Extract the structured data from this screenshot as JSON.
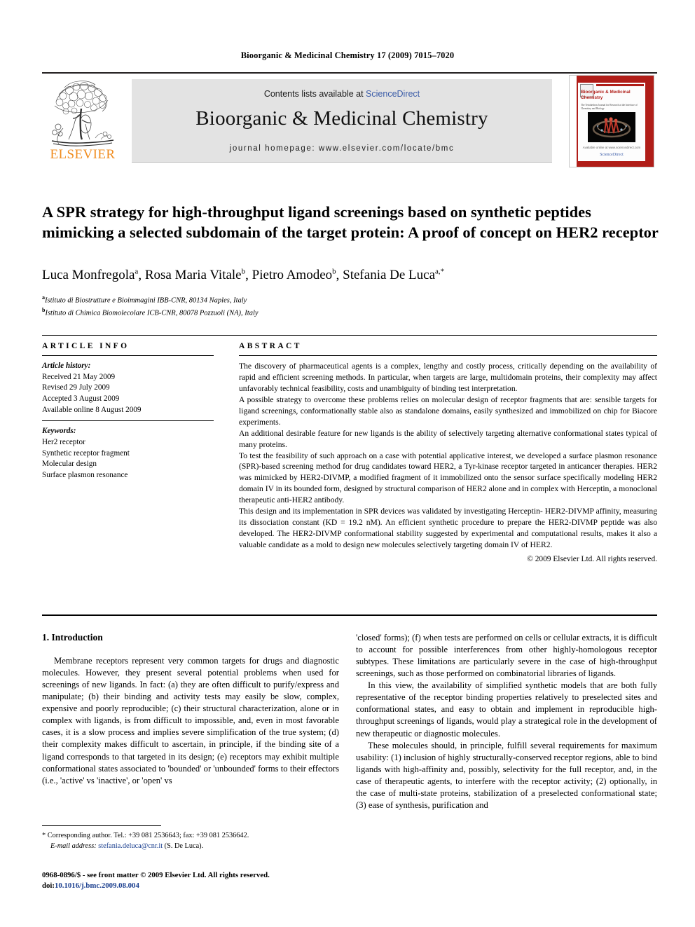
{
  "running_head": "Bioorganic & Medicinal Chemistry 17 (2009) 7015–7020",
  "masthead": {
    "contents_prefix": "Contents lists available at ",
    "sciencedirect": "ScienceDirect",
    "journal_title": "Bioorganic & Medicinal Chemistry",
    "homepage": "journal homepage: www.elsevier.com/locate/bmc",
    "publisher_wordmark": "ELSEVIER",
    "publisher_logo_name": "elsevier-tree-logo",
    "accent_blue": "#3b5ca8",
    "accent_orange": "#F08C1E",
    "band_gray": "#e3e3e3"
  },
  "cover": {
    "title": "Bioorganic & Medicinal Chemistry",
    "subtitle": "The Tetrahedron Journal for Research at the Interface of Chemistry and Biology",
    "footer": "Available online at www.sciencedirect.com",
    "sciencedirect": "ScienceDirect",
    "border_color": "#b01d18"
  },
  "article": {
    "title": "A SPR strategy for high-throughput ligand screenings based on synthetic peptides mimicking a selected subdomain of the target protein: A proof of concept on HER2 receptor",
    "authors": [
      {
        "name": "Luca Monfregola",
        "mark": "a"
      },
      {
        "name": "Rosa Maria Vitale",
        "mark": "b"
      },
      {
        "name": "Pietro Amodeo",
        "mark": "b"
      },
      {
        "name": "Stefania De Luca",
        "mark": "a,*"
      }
    ],
    "affiliations": [
      {
        "mark": "a",
        "text": "Istituto di Biostrutture e Bioimmagini IBB-CNR, 80134 Naples, Italy"
      },
      {
        "mark": "b",
        "text": "Istituto di Chimica Biomolecolare ICB-CNR, 80078 Pozzuoli (NA), Italy"
      }
    ]
  },
  "article_info": {
    "heading": "ARTICLE INFO",
    "history_label": "Article history:",
    "history": [
      "Received 21 May 2009",
      "Revised 29 July 2009",
      "Accepted 3 August 2009",
      "Available online 8 August 2009"
    ],
    "keywords_label": "Keywords:",
    "keywords": [
      "Her2 receptor",
      "Synthetic receptor fragment",
      "Molecular design",
      "Surface plasmon resonance"
    ]
  },
  "abstract": {
    "heading": "ABSTRACT",
    "paragraphs": [
      "The discovery of pharmaceutical agents is a complex, lengthy and costly process, critically depending on the availability of rapid and efficient screening methods. In particular, when targets are large, multidomain proteins, their complexity may affect unfavorably technical feasibility, costs and unambiguity of binding test interpretation.",
      "A possible strategy to overcome these problems relies on molecular design of receptor fragments that are: sensible targets for ligand screenings, conformationally stable also as standalone domains, easily synthesized and immobilized on chip for Biacore experiments.",
      "An additional desirable feature for new ligands is the ability of selectively targeting alternative conformational states typical of many proteins.",
      "To test the feasibility of such approach on a case with potential applicative interest, we developed a surface plasmon resonance (SPR)-based screening method for drug candidates toward HER2, a Tyr-kinase receptor targeted in anticancer therapies. HER2 was mimicked by HER2-DIVMP, a modified fragment of it immobilized onto the sensor surface specifically modeling HER2 domain IV in its bounded form, designed by structural comparison of HER2 alone and in complex with Herceptin, a monoclonal therapeutic anti-HER2 antibody.",
      "This design and its implementation in SPR devices was validated by investigating Herceptin- HER2-DIVMP affinity, measuring its dissociation constant (KD = 19.2 nM). An efficient synthetic procedure to prepare the HER2-DIVMP peptide was also developed. The HER2-DIVMP conformational stability suggested by experimental and computational results, makes it also a valuable candidate as a mold to design new molecules selectively targeting domain IV of HER2."
    ],
    "copyright": "© 2009 Elsevier Ltd. All rights reserved."
  },
  "body": {
    "section_heading": "1. Introduction",
    "left_paragraphs": [
      "Membrane receptors represent very common targets for drugs and diagnostic molecules. However, they present several potential problems when used for screenings of new ligands. In fact: (a) they are often difficult to purify/express and manipulate; (b) their binding and activity tests may easily be slow, complex, expensive and poorly reproducible; (c) their structural characterization, alone or in complex with ligands, is from difficult to impossible, and, even in most favorable cases, it is a slow process and implies severe simplification of the true system; (d) their complexity makes difficult to ascertain, in principle, if the binding site of a ligand corresponds to that targeted in its design; (e) receptors may exhibit multiple conformational states associated to 'bounded' or 'unbounded' forms to their effectors (i.e., 'active' vs 'inactive', or 'open' vs"
    ],
    "right_paragraphs": [
      "'closed' forms); (f) when tests are performed on cells or cellular extracts, it is difficult to account for possible interferences from other highly-homologous receptor subtypes. These limitations are particularly severe in the case of high-throughput screenings, such as those performed on combinatorial libraries of ligands.",
      "In this view, the availability of simplified synthetic models that are both fully representative of the receptor binding properties relatively to preselected sites and conformational states, and easy to obtain and implement in reproducible high-throughput screenings of ligands, would play a strategical role in the development of new therapeutic or diagnostic molecules.",
      "These molecules should, in principle, fulfill several requirements for maximum usability: (1) inclusion of highly structurally-conserved receptor regions, able to bind ligands with high-affinity and, possibly, selectivity for the full receptor, and, in the case of therapeutic agents, to interfere with the receptor activity; (2) optionally, in the case of multi-state proteins, stabilization of a preselected conformational state; (3) ease of synthesis, purification and"
    ]
  },
  "footnote": {
    "corresponding": "Corresponding author. Tel.: +39 081 2536643; fax: +39 081 2536642.",
    "email_label": "E-mail address:",
    "email": "stefania.deluca@cnr.it",
    "email_suffix": "(S. De Luca)."
  },
  "imprint": {
    "line1": "0968-0896/$ - see front matter © 2009 Elsevier Ltd. All rights reserved.",
    "doi_label": "doi:",
    "doi": "10.1016/j.bmc.2009.08.004"
  }
}
